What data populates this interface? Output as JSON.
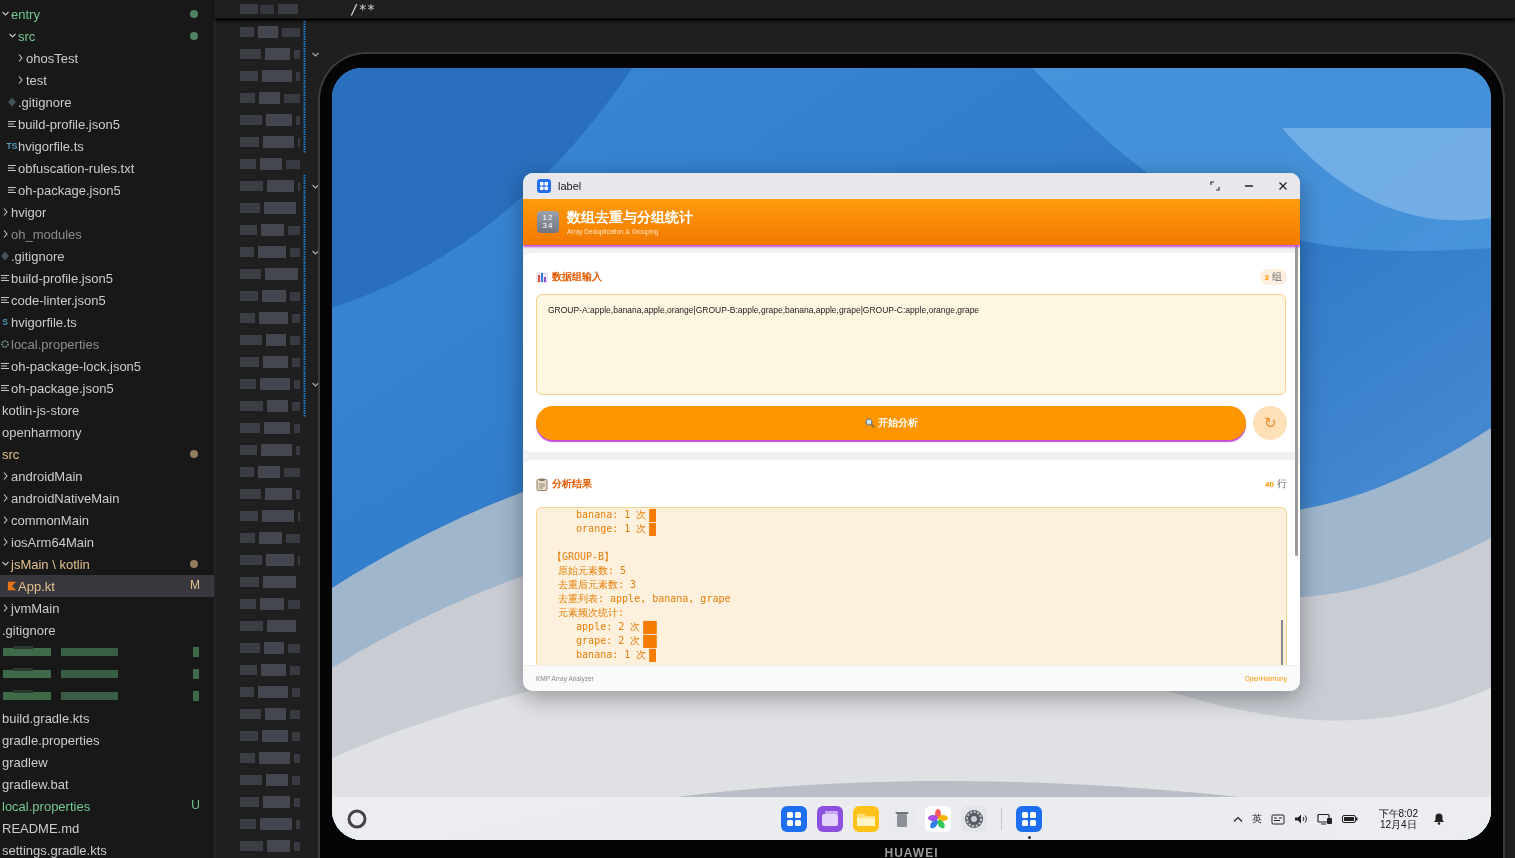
{
  "explorer": {
    "continued_items": [
      {
        "label": "entry",
        "kind": "folder",
        "expanded": true,
        "color": "#73c991",
        "dot": true,
        "selected": false,
        "children": [
          {
            "label": "src",
            "kind": "folder",
            "expanded": true,
            "color": "#73c991",
            "dot": true,
            "selected": false,
            "children": [
              {
                "label": "ohosTest",
                "kind": "folder",
                "expanded": false,
                "selected": false
              },
              {
                "label": "test",
                "kind": "folder",
                "expanded": false,
                "selected": false
              }
            ]
          },
          {
            "label": ".gitignore",
            "kind": "git-file",
            "selected": false
          },
          {
            "label": "build-profile.json5",
            "kind": "text-file",
            "selected": false
          },
          {
            "label": "hvigorfile.ts",
            "kind": "ts-file",
            "icon_text": "TS",
            "selected": false
          },
          {
            "label": "obfuscation-rules.txt",
            "kind": "text-file",
            "selected": false
          },
          {
            "label": "oh-package.json5",
            "kind": "text-file",
            "selected": false
          }
        ]
      },
      {
        "label": "hvigor",
        "kind": "folder",
        "expanded": false,
        "selected": false
      },
      {
        "label": "oh_modules",
        "kind": "folder",
        "expanded": false,
        "color": "#8c8c8c",
        "selected": false
      },
      {
        "label": ".gitignore",
        "kind": "git-file",
        "selected": false
      },
      {
        "label": "build-profile.json5",
        "kind": "text-file",
        "selected": false
      },
      {
        "label": "code-linter.json5",
        "kind": "text-file",
        "selected": false
      },
      {
        "label": "hvigorfile.ts",
        "kind": "ts-file",
        "icon_text": "S",
        "selected": false
      },
      {
        "label": "local.properties",
        "kind": "properties-file",
        "color": "#8c8c8c",
        "selected": false
      },
      {
        "label": "oh-package-lock.json5",
        "kind": "text-file",
        "selected": false
      },
      {
        "label": "oh-package.json5",
        "kind": "text-file",
        "selected": false
      }
    ],
    "items": [
      {
        "label": "kotlin-js-store",
        "kind": "folder",
        "selected": false
      },
      {
        "label": "openharmony",
        "kind": "folder",
        "selected": false
      },
      {
        "label": "src",
        "kind": "folder",
        "color": "#e2c08d",
        "dot": true,
        "selected": false,
        "children": [
          {
            "label": "androidMain",
            "kind": "folder",
            "expanded": false,
            "selected": false
          },
          {
            "label": "androidNativeMain",
            "kind": "folder",
            "expanded": false,
            "selected": false
          },
          {
            "label": "commonMain",
            "kind": "folder",
            "expanded": false,
            "selected": false
          },
          {
            "label": "iosArm64Main",
            "kind": "folder",
            "expanded": false,
            "selected": false
          },
          {
            "label": "jsMain \\ kotlin",
            "kind": "folder",
            "expanded": true,
            "color": "#e2c08d",
            "dot": true,
            "selected": false,
            "children": [
              {
                "label": "App.kt",
                "kind": "kotlin-file",
                "color": "#e2c08d",
                "badge": "M",
                "selected": true
              }
            ]
          },
          {
            "label": "jvmMain",
            "kind": "folder",
            "expanded": false,
            "selected": false
          }
        ]
      },
      {
        "label": ".gitignore",
        "kind": "file",
        "selected": false
      },
      {
        "kind": "redacted"
      },
      {
        "kind": "redacted"
      },
      {
        "kind": "redacted"
      },
      {
        "label": "build.gradle.kts",
        "kind": "file",
        "selected": false
      },
      {
        "label": "gradle.properties",
        "kind": "file",
        "selected": false
      },
      {
        "label": "gradlew",
        "kind": "file",
        "selected": false
      },
      {
        "label": "gradlew.bat",
        "kind": "file",
        "selected": false
      },
      {
        "label": "local.properties",
        "kind": "file",
        "color": "#73c991",
        "badge": "U",
        "selected": false
      },
      {
        "label": "README.md",
        "kind": "file",
        "selected": false
      },
      {
        "label": "settings.gradle.kts",
        "kind": "file",
        "selected": false
      }
    ]
  },
  "editor": {
    "code_line": "/**"
  },
  "tablet": {
    "brand": "HUAWEI",
    "app_window": {
      "title": "label",
      "header": {
        "icon_text": [
          "12",
          "34"
        ],
        "title": "数组去重与分组统计",
        "subtitle": "Array Deduplication & Grouping"
      },
      "input_card": {
        "heading": "数据组输入",
        "count": "3",
        "count_unit": "组",
        "value": "GROUP-A:apple,banana,apple,orange|GROUP-B:apple,grape,banana,apple,grape|GROUP-C:apple,orange,grape",
        "button": "开始分析",
        "reset_button": "↻"
      },
      "result_card": {
        "heading": "分析结果",
        "count": "40",
        "count_unit": "行",
        "lines": [
          {
            "kind": "text",
            "text": "    banana: 1 次",
            "bar": "█"
          },
          {
            "kind": "text",
            "text": "    orange: 1 次",
            "bar": "█"
          },
          {
            "kind": "blank"
          },
          {
            "kind": "text",
            "text": "【GROUP-B】"
          },
          {
            "kind": "text",
            "text": " 原始元素数: 5"
          },
          {
            "kind": "text",
            "text": " 去重后元素数: 3"
          },
          {
            "kind": "text",
            "text": " 去重列表: apple, banana, grape"
          },
          {
            "kind": "text",
            "text": " 元素频次统计:"
          },
          {
            "kind": "text",
            "text": "    apple: 2 次",
            "bar": "██"
          },
          {
            "kind": "text",
            "text": "    grape: 2 次",
            "bar": "██"
          },
          {
            "kind": "text",
            "text": "    banana: 1 次",
            "bar": "█"
          }
        ]
      },
      "footer": {
        "left": "KMP Array Analyzer",
        "right": "OpenHarmony"
      }
    },
    "taskbar": {
      "dock": [
        {
          "kind": "launcher",
          "running": false
        },
        {
          "kind": "multitask",
          "running": false
        },
        {
          "kind": "files",
          "running": false
        },
        {
          "kind": "trash",
          "running": false
        },
        {
          "kind": "photos",
          "running": false
        },
        {
          "kind": "settings",
          "running": false
        },
        {
          "kind": "separator"
        },
        {
          "kind": "launcher",
          "running": true
        }
      ],
      "ime": "英",
      "time": "下午8:02",
      "date": "12月4日"
    }
  }
}
